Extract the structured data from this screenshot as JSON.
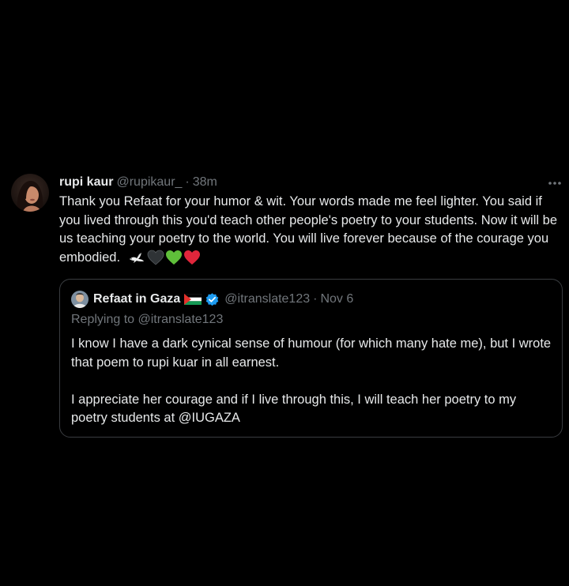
{
  "tweet": {
    "author_name": "rupi kaur",
    "author_handle": "@rupikaur_",
    "separator": "·",
    "time": "38m",
    "text": "Thank you Refaat for your humor & wit. Your words made me feel lighter. You said if you lived through this you'd teach other people's poetry to your students. Now it will be us teaching your poetry to the world. You will live forever because of the courage you embodied.",
    "emojis": [
      "dove-icon",
      "black-heart-icon",
      "green-heart-icon",
      "red-heart-icon"
    ],
    "more_icon": "more-options-icon"
  },
  "quoted_tweet": {
    "author_name": "Refaat in Gaza",
    "flag_icon": "palestine-flag-icon",
    "verified_icon": "verified-badge-icon",
    "author_handle": "@itranslate123",
    "separator": "·",
    "date": "Nov 6",
    "replying_to": "Replying to @itranslate123",
    "paragraphs": [
      "I know I have a dark cynical sense of humour (for which many hate me), but I wrote that poem to rupi kuar in all earnest.",
      "I appreciate her courage and if I live through this, I will teach her poetry to my poetry students at @IUGAZA"
    ]
  },
  "colors": {
    "background": "#000000",
    "primary_text": "#e7e9ea",
    "secondary_text": "#71767b",
    "border": "#3a3d41",
    "verified_blue": "#1d9bf0"
  }
}
